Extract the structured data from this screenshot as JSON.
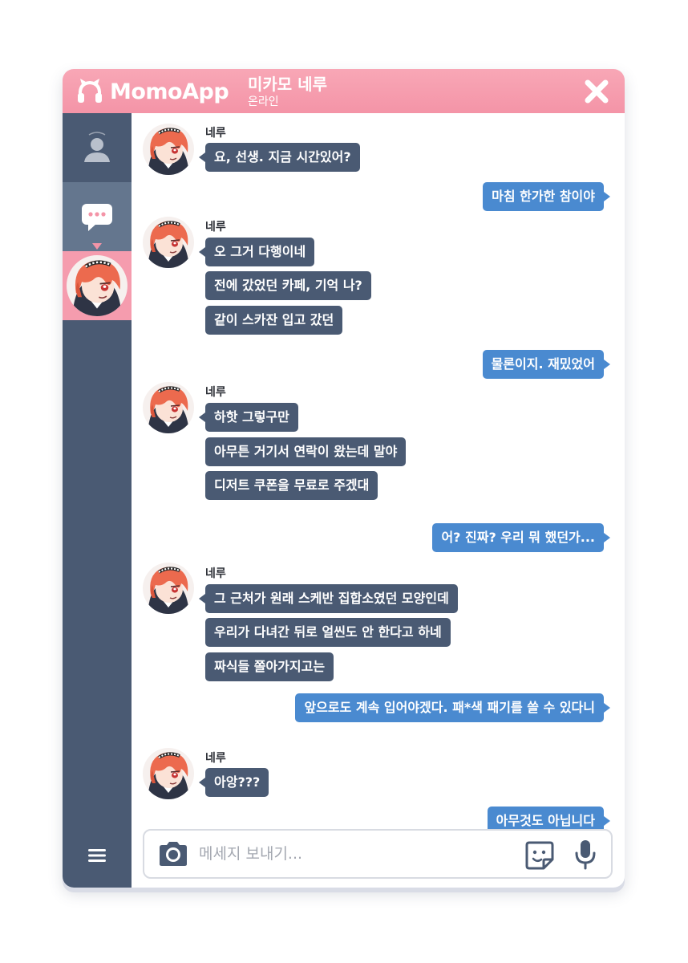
{
  "app": {
    "name": "MomoApp",
    "logo_icon": "headphones-icon",
    "accent_color": "#f494a7",
    "sidebar_color": "#4a5a73",
    "outgoing_color": "#4a8ad0"
  },
  "header": {
    "contact_name": "미카모 네루",
    "status": "온라인",
    "close_icon": "close-icon"
  },
  "sidebar": {
    "items": [
      {
        "icon": "person-icon",
        "active": false
      },
      {
        "icon": "chat-bubble-icon",
        "active": true
      },
      {
        "icon": "contact-avatar",
        "active": true
      },
      {
        "icon": "menu-icon",
        "active": false
      }
    ]
  },
  "messages": [
    {
      "side": "in",
      "sender": "네루",
      "text": "요, 선생. 지금 시간있어?"
    },
    {
      "side": "out",
      "text": "마침 한가한 참이야"
    },
    {
      "side": "in",
      "sender": "네루",
      "text": "오 그거 다행이네"
    },
    {
      "side": "in",
      "text": "전에 갔었던 카페, 기억 나?"
    },
    {
      "side": "in",
      "text": "같이 스카잔 입고 갔던"
    },
    {
      "side": "out",
      "text": "물론이지. 재밌었어"
    },
    {
      "side": "in",
      "sender": "네루",
      "text": "하핫 그렇구만"
    },
    {
      "side": "in",
      "text": "아무튼 거기서 연락이 왔는데 말야"
    },
    {
      "side": "in",
      "text": "디저트 쿠폰을 무료로 주겠대"
    },
    {
      "side": "out",
      "text": "어? 진짜? 우리 뭐 했던가..."
    },
    {
      "side": "in",
      "sender": "네루",
      "text": "그 근처가 원래 스케반 집합소였던 모양인데"
    },
    {
      "side": "in",
      "text": "우리가 다녀간 뒤로 얼씬도 안 한다고 하네"
    },
    {
      "side": "in",
      "text": "짜식들 쫄아가지고는"
    },
    {
      "side": "out",
      "text": "앞으로도 계속 입어야겠다. 패*색 패기를 쓸 수 있다니"
    },
    {
      "side": "in",
      "sender": "네루",
      "text": "아앙???"
    },
    {
      "side": "out",
      "text": "아무것도 아닙니다"
    }
  ],
  "composer": {
    "placeholder": "메세지 보내기...",
    "camera_icon": "camera-icon",
    "sticker_icon": "sticker-icon",
    "mic_icon": "microphone-icon"
  }
}
